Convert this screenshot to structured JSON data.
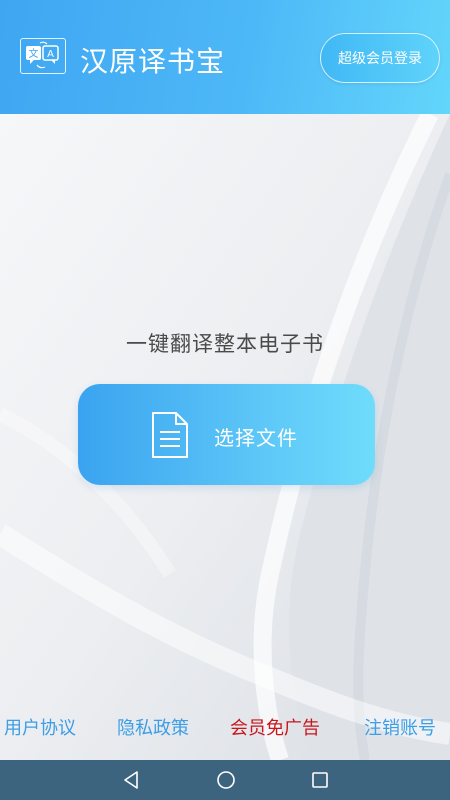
{
  "header": {
    "app_title": "汉原译书宝",
    "logo_icon": "translate-icon",
    "vip_button_label": "超级会员登录"
  },
  "main": {
    "tagline": "一键翻译整本电子书",
    "select_file": {
      "icon": "document-icon",
      "label": "选择文件"
    }
  },
  "footer": {
    "links": [
      {
        "label": "用户协议",
        "color": "#3b9ee6"
      },
      {
        "label": "隐私政策",
        "color": "#3b9ee6"
      },
      {
        "label": "会员免广告",
        "color": "#c8161d"
      },
      {
        "label": "注销账号",
        "color": "#3b9ee6"
      }
    ]
  },
  "system_nav": {
    "back_icon": "back-triangle-icon",
    "home_icon": "home-circle-icon",
    "recents_icon": "recents-square-icon"
  },
  "colors": {
    "header_gradient_start": "#3fa6f2",
    "header_gradient_end": "#63d6fb",
    "button_gradient_start": "#3aa3f0",
    "button_gradient_end": "#6fdcfb",
    "navbar": "#3c647e"
  }
}
